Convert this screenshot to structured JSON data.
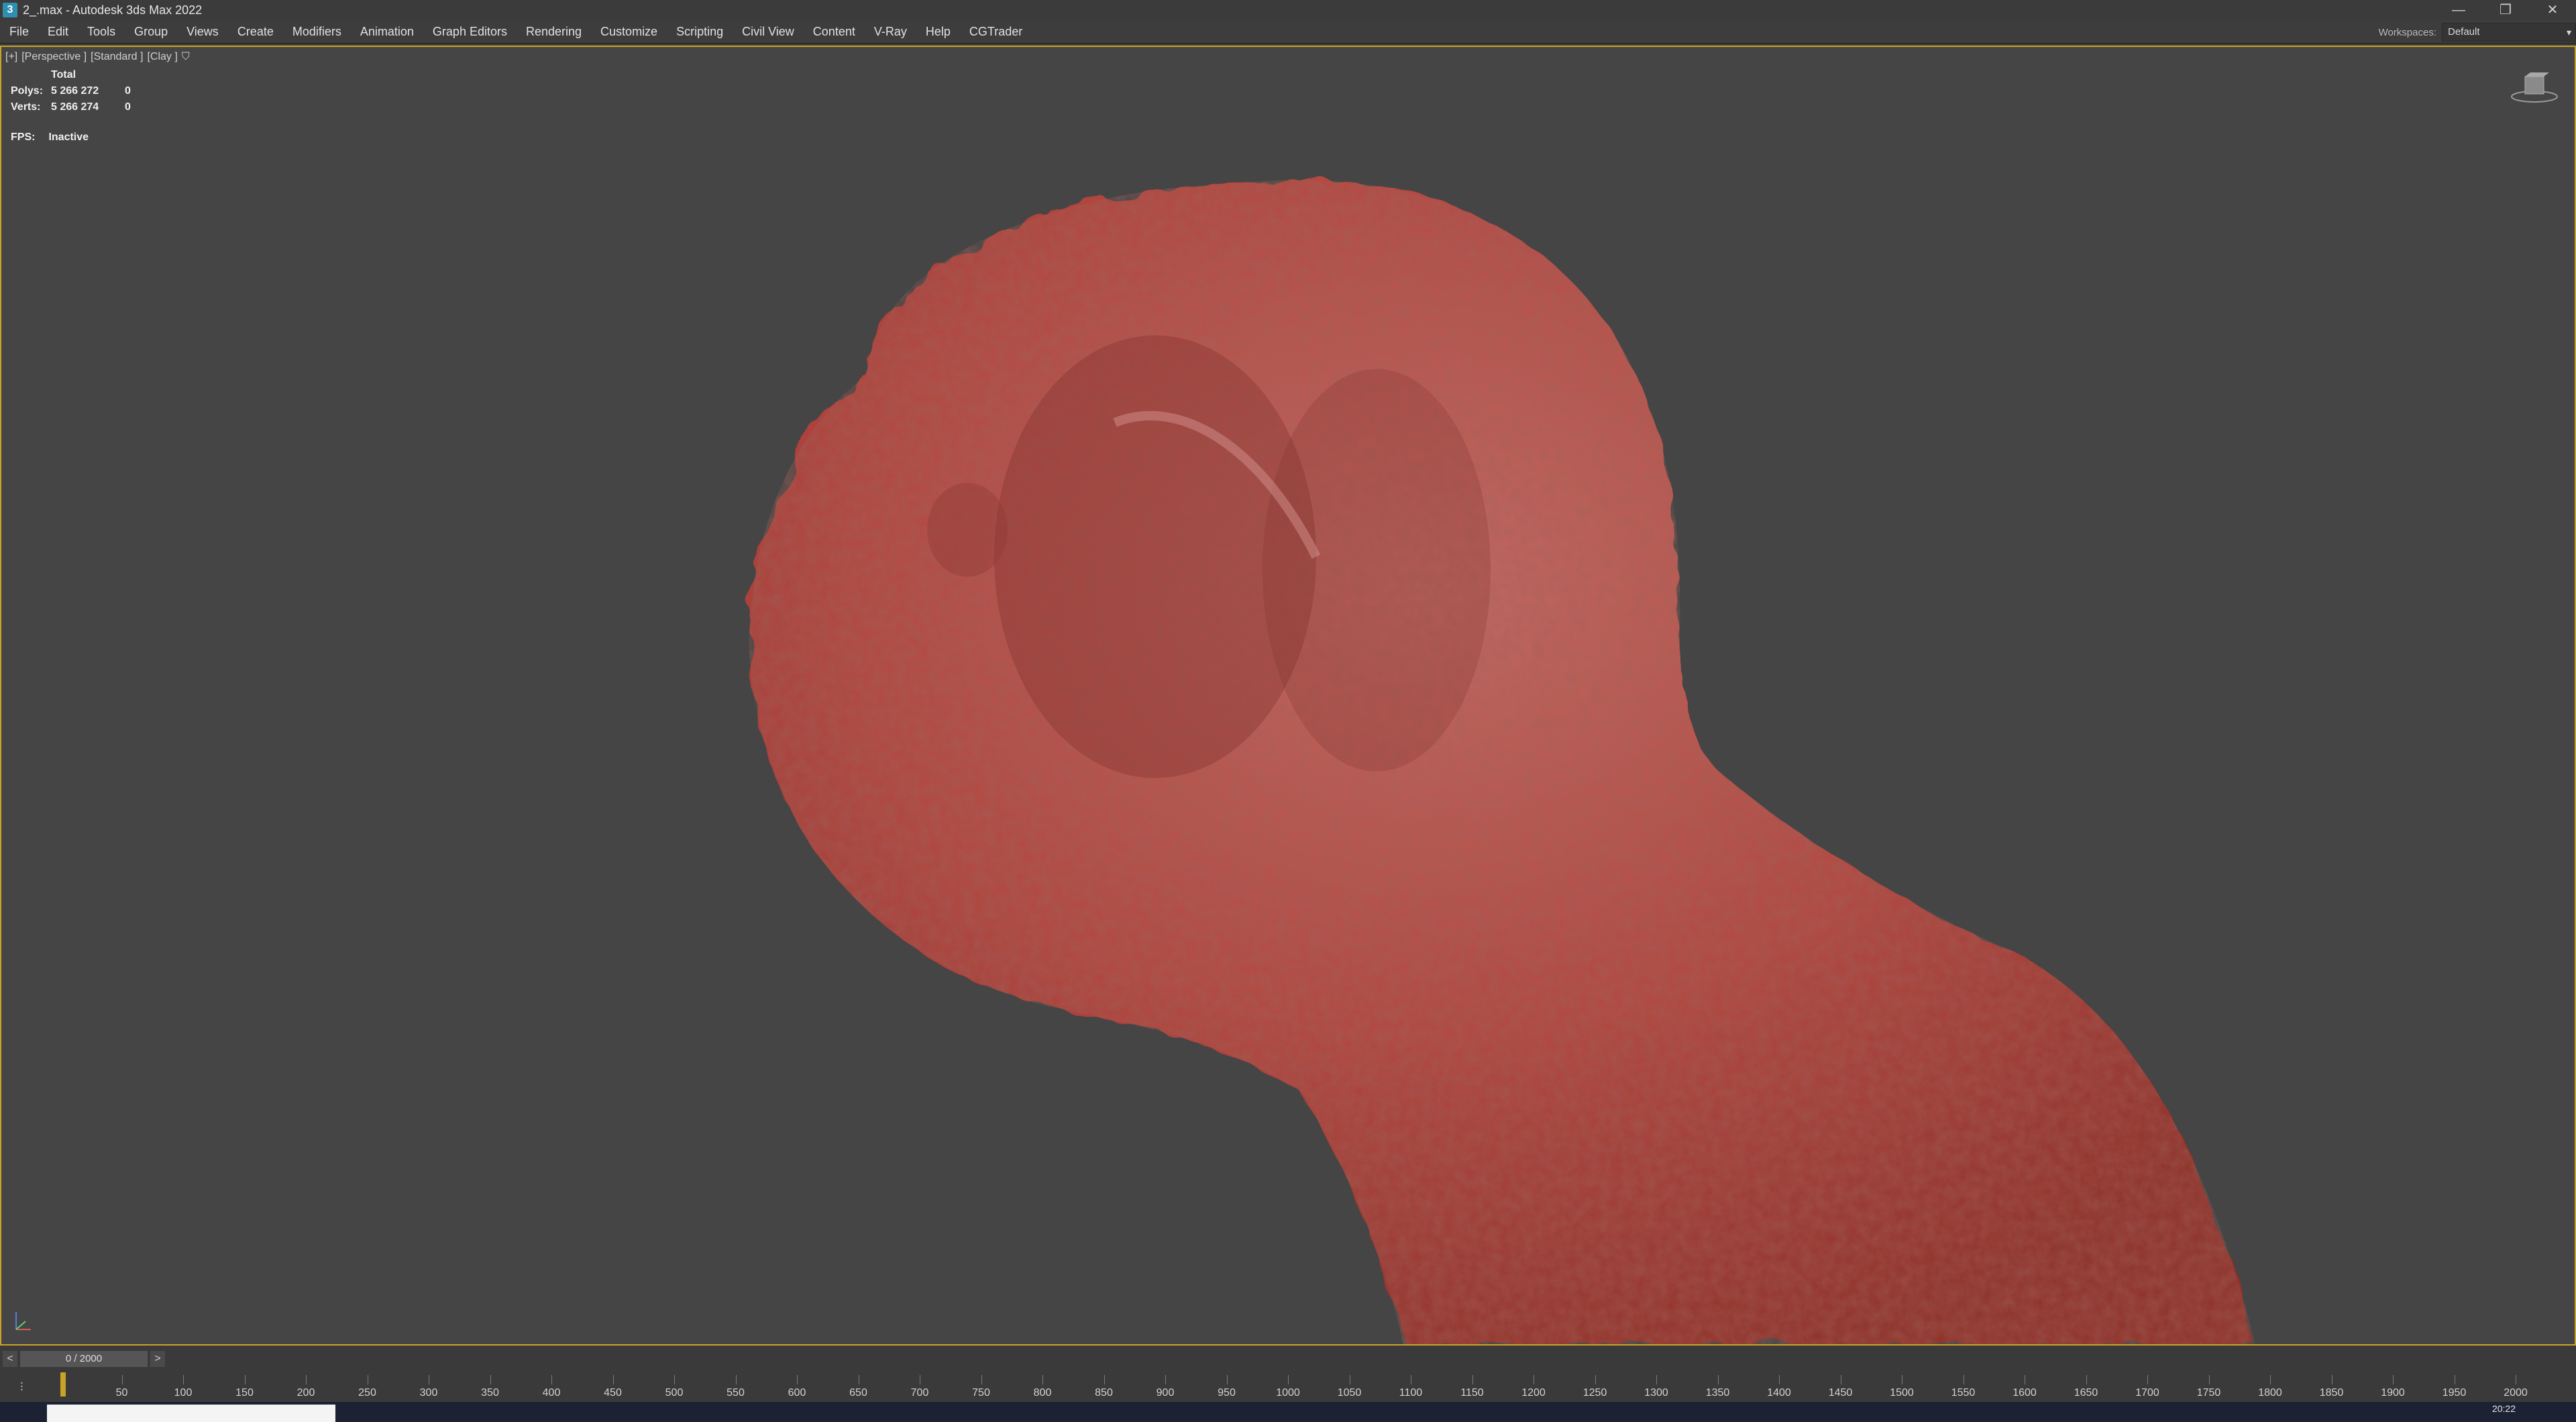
{
  "window": {
    "app_icon_letter": "3",
    "title": "2_.max - Autodesk 3ds Max 2022",
    "controls": [
      "—",
      "❐",
      "✕"
    ]
  },
  "menu": [
    "File",
    "Edit",
    "Tools",
    "Group",
    "Views",
    "Create",
    "Modifiers",
    "Animation",
    "Graph Editors",
    "Rendering",
    "Customize",
    "Scripting",
    "Civil View",
    "Content",
    "V-Ray",
    "Help",
    "CGTrader"
  ],
  "workspaces": {
    "label": "Workspaces:",
    "value": "Default"
  },
  "viewport": {
    "labels": [
      "[+]",
      "[Perspective ]",
      "[Standard ]",
      "[Clay ]"
    ],
    "stats": {
      "header": "Total",
      "polys_label": "Polys:",
      "polys_value": "5 266 272",
      "polys_sel": "0",
      "verts_label": "Verts:",
      "verts_value": "5 266 274",
      "verts_sel": "0"
    },
    "fps_label": "FPS:",
    "fps_value": "Inactive",
    "model_color": "#b84a44"
  },
  "timeslider": {
    "prev": "<",
    "next": ">",
    "frame": "0 / 2000"
  },
  "trackbar": {
    "ticks": [
      "50",
      "100",
      "150",
      "200",
      "250",
      "300",
      "350",
      "400",
      "450",
      "500",
      "550",
      "600",
      "650",
      "700",
      "750",
      "800",
      "850",
      "900",
      "950",
      "1000",
      "1050",
      "1100",
      "1150",
      "1200",
      "1250",
      "1300",
      "1350",
      "1400",
      "1450",
      "1500",
      "1550",
      "1600",
      "1650",
      "1700",
      "1750",
      "1800",
      "1850",
      "1900",
      "1950",
      "2000"
    ]
  },
  "taskbar": {
    "clock": "20:22"
  }
}
